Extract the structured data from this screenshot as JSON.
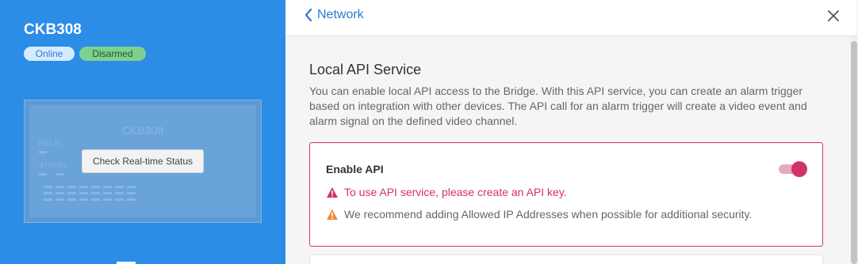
{
  "device": {
    "name": "CKB308",
    "status_online": "Online",
    "status_armed": "Disarmed",
    "image_title": "CKB308",
    "image_labels": [
      "RELAY",
      "STATUS"
    ],
    "check_button": "Check Real-time Status"
  },
  "nav": {
    "back_label": "Network",
    "back_icon": "chevron-left-icon",
    "close_icon": "close-icon"
  },
  "section": {
    "title": "Local API Service",
    "description": "You can enable local API access to the Bridge. With this API service, you can create an alarm trigger based on integration with other devices. The API call for an alarm trigger will create a video event and alarm signal on the defined video channel."
  },
  "api_card": {
    "enable_label": "Enable API",
    "enabled": true,
    "error_message": "To use API service, please create an API key.",
    "warning_message": "We recommend adding Allowed IP Addresses when possible for additional security."
  },
  "colors": {
    "brand_blue": "#2b8de6",
    "link_blue": "#2a7bd1",
    "error": "#d33160",
    "warning": "#f08a3c",
    "toggle_on": "#cf3464"
  }
}
